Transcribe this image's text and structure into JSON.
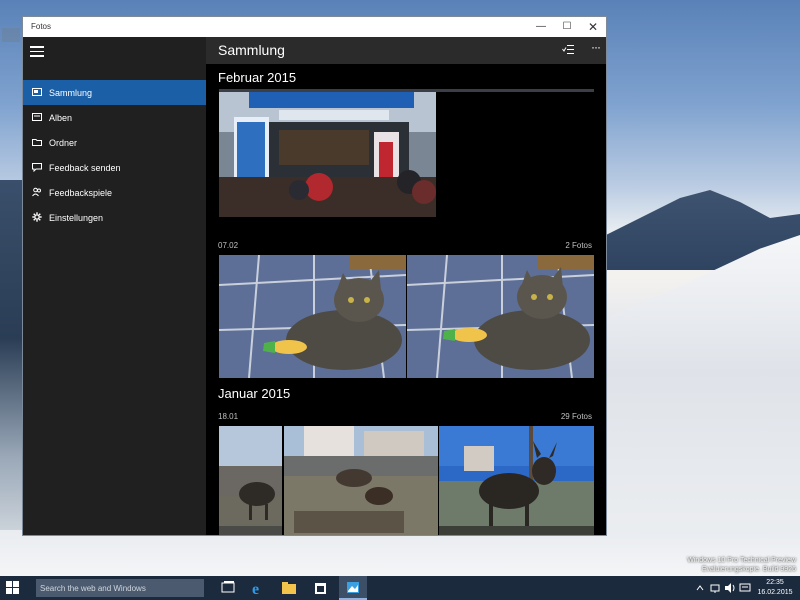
{
  "window": {
    "title": "Fotos",
    "controls": {
      "minimize": "—",
      "maximize": "☐",
      "close": "✕"
    }
  },
  "sidebar": {
    "menu_icon": "hamburger-icon",
    "items": [
      {
        "label": "Sammlung",
        "icon": "collection-icon",
        "active": true
      },
      {
        "label": "Alben",
        "icon": "album-icon",
        "active": false
      },
      {
        "label": "Ordner",
        "icon": "folder-icon",
        "active": false
      },
      {
        "label": "Feedback senden",
        "icon": "feedback-icon",
        "active": false
      },
      {
        "label": "Feedbackspiele",
        "icon": "people-icon",
        "active": false
      },
      {
        "label": "Einstellungen",
        "icon": "gear-icon",
        "active": false
      }
    ],
    "accent": "#1b5fa6"
  },
  "main": {
    "title": "Sammlung",
    "select_icon": "select-icon",
    "more_label": "···",
    "groups": [
      {
        "month": "Februar 2015",
        "days": [
          {
            "date": "",
            "count": ""
          },
          {
            "date": "07.02",
            "count": "2 Fotos"
          }
        ]
      },
      {
        "month": "Januar 2015",
        "days": [
          {
            "date": "18.01",
            "count": "29 Fotos"
          }
        ]
      }
    ]
  },
  "desktop": {
    "watermark_line1": "Windows 10 Pro Technical Preview",
    "watermark_line2": "Evaluierungskopie. Build 9926"
  },
  "taskbar": {
    "search_placeholder": "Search the web and Windows",
    "apps": [
      "task-view-icon",
      "internet-explorer-icon",
      "file-explorer-icon",
      "store-icon",
      "photos-icon"
    ],
    "time": "22:35",
    "date": "16.02.2015"
  }
}
